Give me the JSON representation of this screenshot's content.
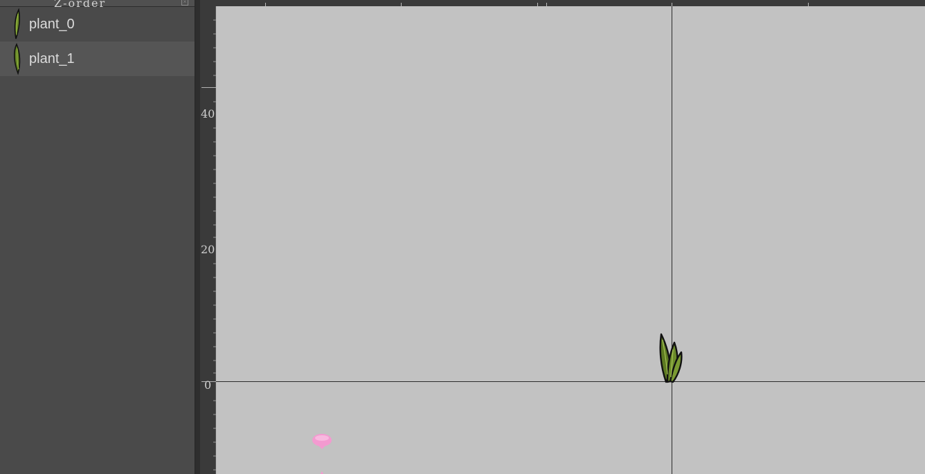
{
  "z_order_panel": {
    "title": "Z-order",
    "close_icon": "close-icon",
    "items": [
      {
        "label": "plant_0",
        "icon": "grass-blade-thumbnail",
        "selected": false
      },
      {
        "label": "plant_1",
        "icon": "grass-blade-thumbnail",
        "selected": true
      }
    ]
  },
  "viewport": {
    "background": "#c2c2c2",
    "left_ruler_labels": [
      "40",
      "20",
      "0"
    ],
    "objects": [
      {
        "name": "plant",
        "icon": "grass-tuft-sprite"
      },
      {
        "name": "pink-petal",
        "icon": "pink-blob-sprite"
      }
    ]
  },
  "colors": {
    "panel_bg": "#4a4a4a",
    "selected_item_bg": "#555555",
    "ruler_bg": "#3a3a3a",
    "canvas_bg": "#c2c2c2",
    "axis_line": "#2a2a2a",
    "plant_green": "#6b8a2a",
    "petal_pink": "#f39ad0"
  }
}
